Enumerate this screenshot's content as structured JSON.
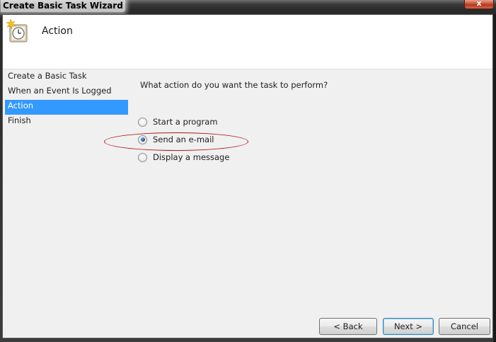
{
  "window": {
    "title": "Create Basic Task Wizard",
    "close_label": "x"
  },
  "header": {
    "title": "Action",
    "icon": "task-scheduler-clock-icon"
  },
  "nav": {
    "items": [
      {
        "label": "Create a Basic Task",
        "selected": false
      },
      {
        "label": "When an Event Is Logged",
        "selected": false
      },
      {
        "label": "Action",
        "selected": true
      },
      {
        "label": "Finish",
        "selected": false
      }
    ]
  },
  "main": {
    "question": "What action do you want the task to perform?",
    "options": [
      {
        "label": "Start a program",
        "checked": false
      },
      {
        "label": "Send an e-mail",
        "checked": true
      },
      {
        "label": "Display a message",
        "checked": false
      }
    ]
  },
  "buttons": {
    "back": "< Back",
    "next": "Next >",
    "cancel": "Cancel"
  },
  "colors": {
    "selection": "#3399ff",
    "annotation": "#b01818"
  }
}
